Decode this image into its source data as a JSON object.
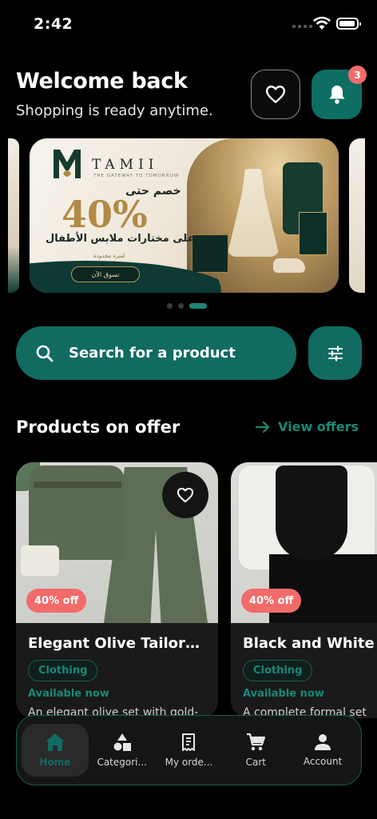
{
  "status_bar": {
    "time": "2:42"
  },
  "header": {
    "title": "Welcome back",
    "subtitle": "Shopping is ready anytime.",
    "notification_count": "3"
  },
  "banner": {
    "brand": "TAMII",
    "brand_tagline": "THE GATEWAY TO TOMORROW",
    "discount_prefix": "خصم حتى",
    "discount_value": "40%",
    "headline": "على مختارات ملابس الأطفال",
    "limited": "لفترة محدودة",
    "cta": "تسوق الآن",
    "pages": 3,
    "active_page": 3
  },
  "search": {
    "placeholder": "Search for a product"
  },
  "offers_section": {
    "title": "Products on offer",
    "view_all": "View offers"
  },
  "products": [
    {
      "title": "Elegant Olive Tailored S...",
      "discount": "40% off",
      "category": "Clothing",
      "availability": "Available now",
      "description": "An elegant olive set with gold-"
    },
    {
      "title": "Black and White F",
      "discount": "40% off",
      "category": "Clothing",
      "availability": "Available now",
      "description": "A complete formal set"
    }
  ],
  "nav": {
    "items": [
      {
        "label": "Home",
        "icon": "home-icon",
        "active": true
      },
      {
        "label": "Categori...",
        "icon": "categories-icon",
        "active": false
      },
      {
        "label": "My orde...",
        "icon": "orders-icon",
        "active": false
      },
      {
        "label": "Cart",
        "icon": "cart-icon",
        "active": false
      },
      {
        "label": "Account",
        "icon": "account-icon",
        "active": false
      }
    ]
  },
  "colors": {
    "accent": "#116b61",
    "accent_text": "#1a8777",
    "badge": "#f26b6b",
    "background": "#000000"
  }
}
